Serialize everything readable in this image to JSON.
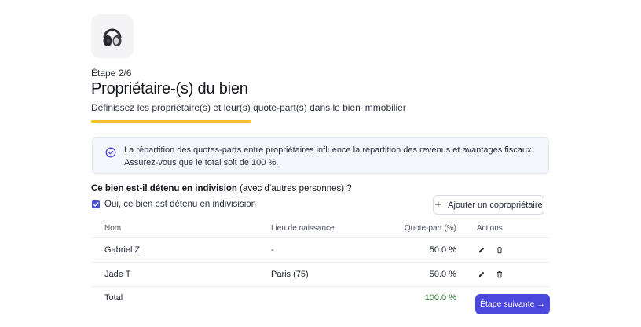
{
  "header": {
    "step_label": "Étape 2/6",
    "title": "Propriétaire-(s) du bien",
    "subtitle": "Définissez les propriétaire(s) et leur(s) quote-part(s) dans le bien immobilier",
    "progress_fraction": 0.35,
    "progress_color": "#f2c12e",
    "logo_icon": "headphones-icon"
  },
  "info": {
    "icon": "check-circle-icon",
    "line1": "La répartition des quotes-parts entre propriétaires influence la répartition des revenus et avantages fiscaux.",
    "line2": "Assurez-vous que le total soit de 100 %."
  },
  "indivision": {
    "question_strong": "Ce bien est-il détenu en indivision",
    "question_rest": " (avec d’autres personnes) ?",
    "checkbox_label": "Oui, ce bien est détenu en indivisision",
    "checked": true,
    "add_button_label": "Ajouter un copropriétaire"
  },
  "table": {
    "headers": {
      "name": "Nom",
      "birthplace": "Lieu de naissance",
      "share": "Quote-part (%)",
      "actions": "Actions"
    },
    "rows": [
      {
        "name": "Gabriel Z",
        "birthplace": "-",
        "share": "50.0 %"
      },
      {
        "name": "Jade T",
        "birthplace": "Paris (75)",
        "share": "50.0 %"
      }
    ],
    "total_label": "Total",
    "total_value": "100.0 %"
  },
  "footer": {
    "next_label": "Étape suivante",
    "next_arrow": "→"
  },
  "colors": {
    "accent": "#4b48de",
    "total_ok": "#2f7d32"
  }
}
